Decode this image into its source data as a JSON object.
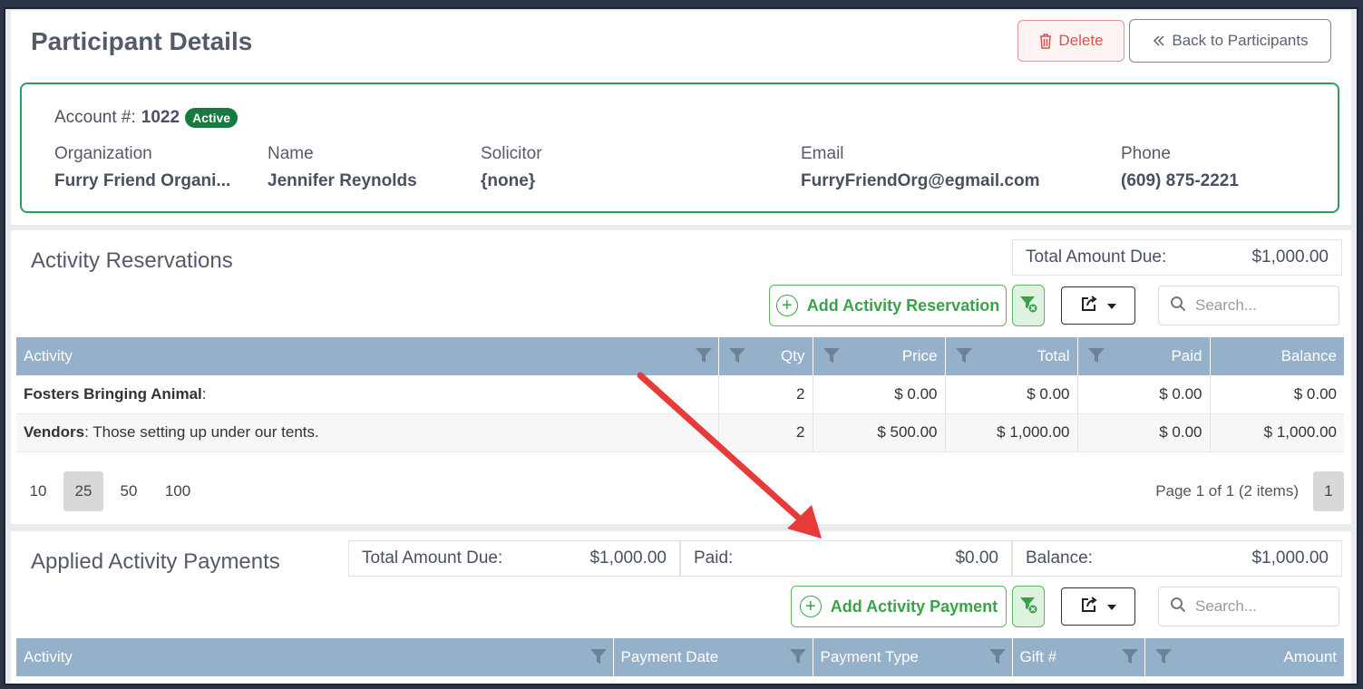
{
  "header": {
    "title": "Participant Details",
    "delete_label": "Delete",
    "back_label": "Back to Participants"
  },
  "account": {
    "label": "Account #:",
    "number": "1022",
    "status": "Active",
    "fields": [
      {
        "label": "Organization",
        "value": "Furry Friend Organi..."
      },
      {
        "label": "Name",
        "value": "Jennifer Reynolds"
      },
      {
        "label": "Solicitor",
        "value": "{none}"
      },
      {
        "label": "Email",
        "value": "FurryFriendOrg@egmail.com"
      },
      {
        "label": "Phone",
        "value": "(609) 875-2221"
      }
    ]
  },
  "reservations": {
    "title": "Activity Reservations",
    "total_due_label": "Total Amount Due:",
    "total_due_value": "$1,000.00",
    "add_label": "Add Activity Reservation",
    "search_placeholder": "Search...",
    "columns": [
      "Activity",
      "Qty",
      "Price",
      "Total",
      "Paid",
      "Balance"
    ],
    "rows": [
      {
        "name": "Fosters Bringing Animal",
        "desc": ":",
        "qty": "2",
        "price": "$ 0.00",
        "total": "$ 0.00",
        "paid": "$ 0.00",
        "balance": "$ 0.00"
      },
      {
        "name": "Vendors",
        "desc": ": Those setting up under our tents.",
        "qty": "2",
        "price": "$ 500.00",
        "total": "$ 1,000.00",
        "paid": "$ 0.00",
        "balance": "$ 1,000.00"
      }
    ],
    "page_sizes": [
      "10",
      "25",
      "50",
      "100"
    ],
    "selected_page_size": "25",
    "page_info": "Page 1 of 1 (2 items)",
    "current_page": "1"
  },
  "payments": {
    "title": "Applied Activity Payments",
    "total_due_label": "Total Amount Due:",
    "total_due_value": "$1,000.00",
    "paid_label": "Paid:",
    "paid_value": "$0.00",
    "balance_label": "Balance:",
    "balance_value": "$1,000.00",
    "add_label": "Add Activity Payment",
    "search_placeholder": "Search...",
    "columns": [
      "Activity",
      "Payment Date",
      "Payment Type",
      "Gift #",
      "Amount"
    ]
  },
  "colors": {
    "accent_green": "#2e9c5f",
    "header_blue": "#95b0c9",
    "delete_red": "#d9534f",
    "arrow_red": "#e8393b"
  }
}
